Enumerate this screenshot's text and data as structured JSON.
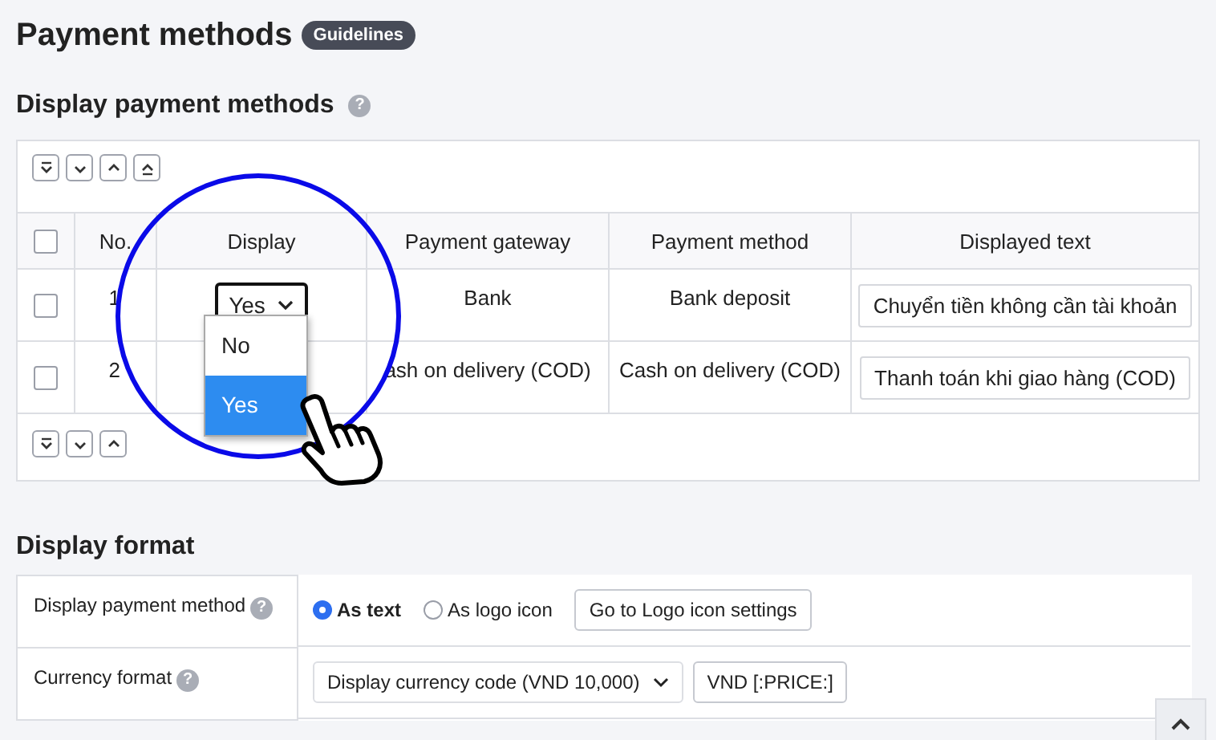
{
  "title": "Payment methods",
  "badge": "Guidelines",
  "section1": {
    "title": "Display payment methods",
    "help": "?",
    "columns": [
      "No.",
      "Display",
      "Payment gateway",
      "Payment method",
      "Displayed text"
    ],
    "rows": [
      {
        "checked": false,
        "no": "1",
        "display": "Yes",
        "gateway": "Bank",
        "method": "Bank deposit",
        "text": "Chuyển tiền không cần tài khoản"
      },
      {
        "checked": false,
        "no": "2",
        "gateway": "ash on delivery (COD)",
        "method": "Cash on delivery (COD)",
        "text": "Thanh toán khi giao hàng (COD)"
      }
    ],
    "header_checked": false,
    "dropdown": [
      {
        "label": "No",
        "selected": false
      },
      {
        "label": "Yes",
        "selected": true
      }
    ]
  },
  "section2": {
    "title": "Display format",
    "payment_label": "Display payment method",
    "payment_help": "?",
    "radios": [
      {
        "label": "As text",
        "selected": true
      },
      {
        "label": "As logo icon",
        "selected": false
      }
    ],
    "logo_button": "Go to Logo icon settings",
    "currency_label": "Currency format",
    "currency_help": "?",
    "currency_select": "Display currency code (VND 10,000)",
    "currency_field": "VND [:PRICE:]"
  }
}
